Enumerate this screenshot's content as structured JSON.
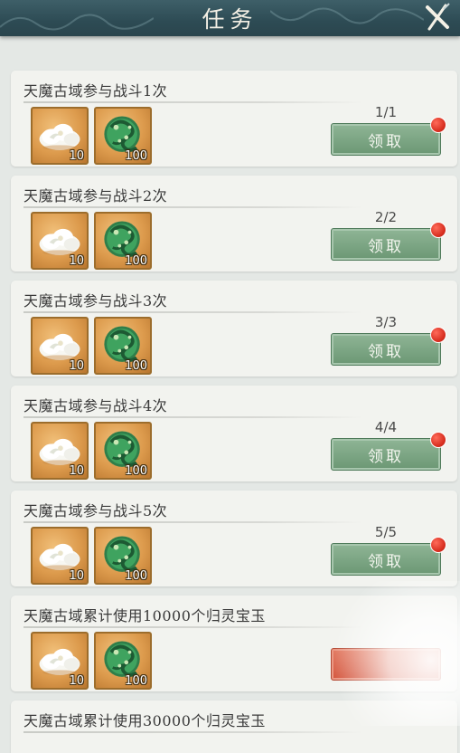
{
  "header": {
    "title": "任务"
  },
  "icons": {
    "close": "close-icon",
    "reward_1": "cloud-item-icon",
    "reward_2": "jade-dragon-item-icon"
  },
  "colors": {
    "header_bg": "#2d4b54",
    "card_bg": "#f2f3ef",
    "claim_button": "#7aa582",
    "red_dot": "#d72e1f"
  },
  "tasks": [
    {
      "title": "天魔古域参与战斗1次",
      "rewards": [
        {
          "icon": "cloud-item-icon",
          "qty": "10"
        },
        {
          "icon": "jade-dragon-item-icon",
          "qty": "100"
        }
      ],
      "progress": "1/1",
      "button": "领取"
    },
    {
      "title": "天魔古域参与战斗2次",
      "rewards": [
        {
          "icon": "cloud-item-icon",
          "qty": "10"
        },
        {
          "icon": "jade-dragon-item-icon",
          "qty": "100"
        }
      ],
      "progress": "2/2",
      "button": "领取"
    },
    {
      "title": "天魔古域参与战斗3次",
      "rewards": [
        {
          "icon": "cloud-item-icon",
          "qty": "10"
        },
        {
          "icon": "jade-dragon-item-icon",
          "qty": "100"
        }
      ],
      "progress": "3/3",
      "button": "领取"
    },
    {
      "title": "天魔古域参与战斗4次",
      "rewards": [
        {
          "icon": "cloud-item-icon",
          "qty": "10"
        },
        {
          "icon": "jade-dragon-item-icon",
          "qty": "100"
        }
      ],
      "progress": "4/4",
      "button": "领取"
    },
    {
      "title": "天魔古域参与战斗5次",
      "rewards": [
        {
          "icon": "cloud-item-icon",
          "qty": "10"
        },
        {
          "icon": "jade-dragon-item-icon",
          "qty": "100"
        }
      ],
      "progress": "5/5",
      "button": "领取"
    },
    {
      "title": "天魔古域累计使用10000个归灵宝玉",
      "rewards": [
        {
          "icon": "cloud-item-icon",
          "qty": "10"
        },
        {
          "icon": "jade-dragon-item-icon",
          "qty": "100"
        }
      ]
    },
    {
      "title": "天魔古域累计使用30000个归灵宝玉",
      "rewards": []
    }
  ]
}
